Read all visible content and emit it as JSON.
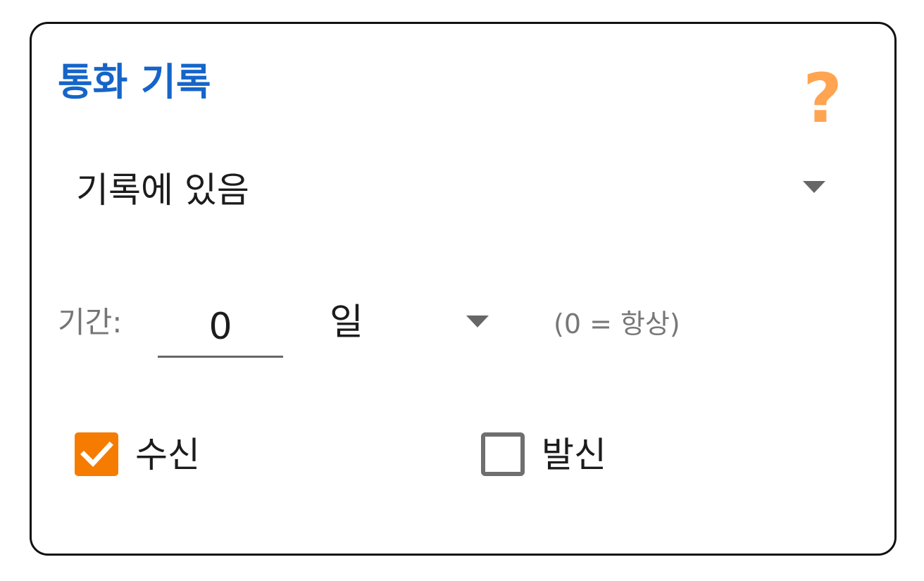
{
  "header": {
    "title": "통화 기록",
    "help_icon": "question-mark-icon",
    "help_glyph": "?",
    "help_color": "#ffa451",
    "title_color": "#1565c8"
  },
  "history_filter": {
    "selected": "기록에 있음"
  },
  "period": {
    "label": "기간:",
    "value": "0",
    "unit": "일",
    "hint": "(0 = 항상)"
  },
  "call_types": {
    "incoming": {
      "label": "수신",
      "checked": true
    },
    "outgoing": {
      "label": "발신",
      "checked": false
    },
    "accent": "#f57c00"
  }
}
